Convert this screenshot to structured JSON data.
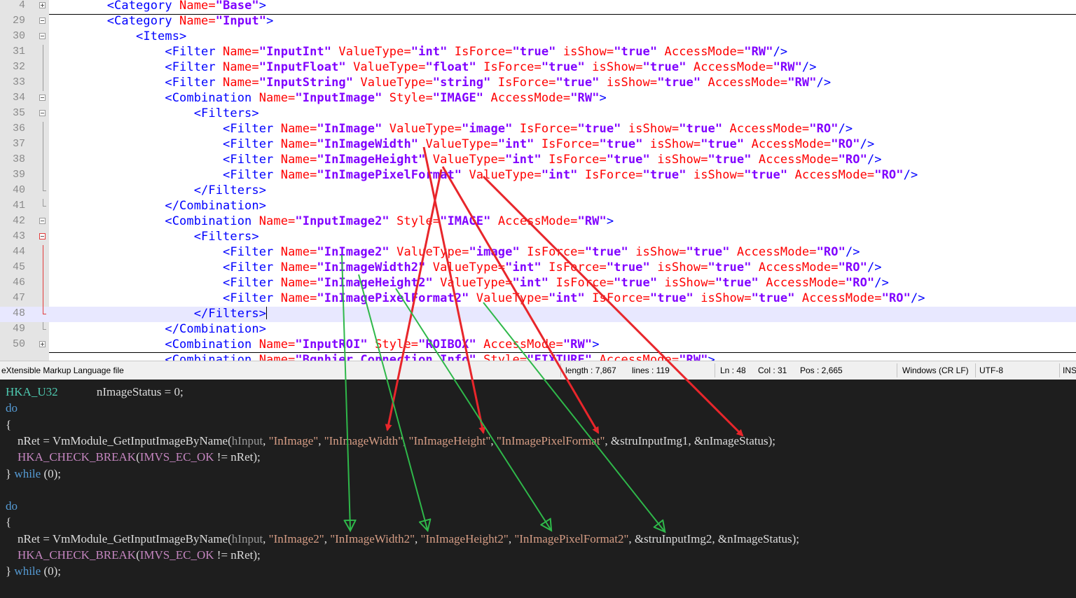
{
  "xml_lines": [
    {
      "num": "4",
      "fold": "plus",
      "segs": [
        [
          "p",
          "        "
        ],
        [
          "t",
          "<Category "
        ],
        [
          "a",
          "Name="
        ],
        [
          "v",
          "\"Base\""
        ],
        [
          "t",
          ">"
        ]
      ]
    },
    {
      "num": "29",
      "fold": "minus",
      "segs": [
        [
          "p",
          "        "
        ],
        [
          "t",
          "<Category "
        ],
        [
          "a",
          "Name="
        ],
        [
          "v",
          "\"Input\""
        ],
        [
          "t",
          ">"
        ]
      ]
    },
    {
      "num": "30",
      "fold": "minus",
      "segs": [
        [
          "p",
          "            "
        ],
        [
          "t",
          "<Items>"
        ]
      ]
    },
    {
      "num": "31",
      "fold": "line",
      "segs": [
        [
          "p",
          "                "
        ],
        [
          "t",
          "<Filter "
        ],
        [
          "a",
          "Name="
        ],
        [
          "v",
          "\"InputInt\""
        ],
        [
          "a",
          " ValueType="
        ],
        [
          "v",
          "\"int\""
        ],
        [
          "a",
          " IsForce="
        ],
        [
          "v",
          "\"true\""
        ],
        [
          "a",
          " isShow="
        ],
        [
          "v",
          "\"true\""
        ],
        [
          "a",
          " AccessMode="
        ],
        [
          "v",
          "\"RW\""
        ],
        [
          "t",
          "/>"
        ]
      ]
    },
    {
      "num": "32",
      "fold": "line",
      "segs": [
        [
          "p",
          "                "
        ],
        [
          "t",
          "<Filter "
        ],
        [
          "a",
          "Name="
        ],
        [
          "v",
          "\"InputFloat\""
        ],
        [
          "a",
          " ValueType="
        ],
        [
          "v",
          "\"float\""
        ],
        [
          "a",
          " IsForce="
        ],
        [
          "v",
          "\"true\""
        ],
        [
          "a",
          " isShow="
        ],
        [
          "v",
          "\"true\""
        ],
        [
          "a",
          " AccessMode="
        ],
        [
          "v",
          "\"RW\""
        ],
        [
          "t",
          "/>"
        ]
      ]
    },
    {
      "num": "33",
      "fold": "line",
      "segs": [
        [
          "p",
          "                "
        ],
        [
          "t",
          "<Filter "
        ],
        [
          "a",
          "Name="
        ],
        [
          "v",
          "\"InputString\""
        ],
        [
          "a",
          " ValueType="
        ],
        [
          "v",
          "\"string\""
        ],
        [
          "a",
          " IsForce="
        ],
        [
          "v",
          "\"true\""
        ],
        [
          "a",
          " isShow="
        ],
        [
          "v",
          "\"true\""
        ],
        [
          "a",
          " AccessMode="
        ],
        [
          "v",
          "\"RW\""
        ],
        [
          "t",
          "/>"
        ]
      ]
    },
    {
      "num": "34",
      "fold": "minus",
      "segs": [
        [
          "p",
          "                "
        ],
        [
          "t",
          "<Combination "
        ],
        [
          "a",
          "Name="
        ],
        [
          "v",
          "\"InputImage\""
        ],
        [
          "a",
          " Style="
        ],
        [
          "v",
          "\"IMAGE\""
        ],
        [
          "a",
          " AccessMode="
        ],
        [
          "v",
          "\"RW\""
        ],
        [
          "t",
          ">"
        ]
      ]
    },
    {
      "num": "35",
      "fold": "minus",
      "segs": [
        [
          "p",
          "                    "
        ],
        [
          "t",
          "<Filters>"
        ]
      ]
    },
    {
      "num": "36",
      "fold": "line",
      "segs": [
        [
          "p",
          "                        "
        ],
        [
          "t",
          "<Filter "
        ],
        [
          "a",
          "Name="
        ],
        [
          "v",
          "\"InImage\""
        ],
        [
          "a",
          " ValueType="
        ],
        [
          "v",
          "\"image\""
        ],
        [
          "a",
          " IsForce="
        ],
        [
          "v",
          "\"true\""
        ],
        [
          "a",
          " isShow="
        ],
        [
          "v",
          "\"true\""
        ],
        [
          "a",
          " AccessMode="
        ],
        [
          "v",
          "\"RO\""
        ],
        [
          "t",
          "/>"
        ]
      ]
    },
    {
      "num": "37",
      "fold": "line",
      "segs": [
        [
          "p",
          "                        "
        ],
        [
          "t",
          "<Filter "
        ],
        [
          "a",
          "Name="
        ],
        [
          "v",
          "\"InImageWidth\""
        ],
        [
          "a",
          " ValueType="
        ],
        [
          "v",
          "\"int\""
        ],
        [
          "a",
          " IsForce="
        ],
        [
          "v",
          "\"true\""
        ],
        [
          "a",
          " isShow="
        ],
        [
          "v",
          "\"true\""
        ],
        [
          "a",
          " AccessMode="
        ],
        [
          "v",
          "\"RO\""
        ],
        [
          "t",
          "/>"
        ]
      ]
    },
    {
      "num": "38",
      "fold": "line",
      "segs": [
        [
          "p",
          "                        "
        ],
        [
          "t",
          "<Filter "
        ],
        [
          "a",
          "Name="
        ],
        [
          "v",
          "\"InImageHeight\""
        ],
        [
          "a",
          " ValueType="
        ],
        [
          "v",
          "\"int\""
        ],
        [
          "a",
          " IsForce="
        ],
        [
          "v",
          "\"true\""
        ],
        [
          "a",
          " isShow="
        ],
        [
          "v",
          "\"true\""
        ],
        [
          "a",
          " AccessMode="
        ],
        [
          "v",
          "\"RO\""
        ],
        [
          "t",
          "/>"
        ]
      ]
    },
    {
      "num": "39",
      "fold": "line",
      "segs": [
        [
          "p",
          "                        "
        ],
        [
          "t",
          "<Filter "
        ],
        [
          "a",
          "Name="
        ],
        [
          "v",
          "\"InImagePixelFormat\""
        ],
        [
          "a",
          " ValueType="
        ],
        [
          "v",
          "\"int\""
        ],
        [
          "a",
          " IsForce="
        ],
        [
          "v",
          "\"true\""
        ],
        [
          "a",
          " isShow="
        ],
        [
          "v",
          "\"true\""
        ],
        [
          "a",
          " AccessMode="
        ],
        [
          "v",
          "\"RO\""
        ],
        [
          "t",
          "/>"
        ]
      ]
    },
    {
      "num": "40",
      "fold": "end",
      "segs": [
        [
          "p",
          "                    "
        ],
        [
          "t",
          "</Filters>"
        ]
      ]
    },
    {
      "num": "41",
      "fold": "end",
      "segs": [
        [
          "p",
          "                "
        ],
        [
          "t",
          "</Combination>"
        ]
      ]
    },
    {
      "num": "42",
      "fold": "minus",
      "segs": [
        [
          "p",
          "                "
        ],
        [
          "t",
          "<Combination "
        ],
        [
          "a",
          "Name="
        ],
        [
          "v",
          "\"InputImage2\""
        ],
        [
          "a",
          " Style="
        ],
        [
          "v",
          "\"IMAGE\""
        ],
        [
          "a",
          " AccessMode="
        ],
        [
          "v",
          "\"RW\""
        ],
        [
          "t",
          ">"
        ]
      ]
    },
    {
      "num": "43",
      "fold": "minus-red",
      "segs": [
        [
          "p",
          "                    "
        ],
        [
          "t",
          "<Filters>"
        ]
      ]
    },
    {
      "num": "44",
      "fold": "line-red",
      "segs": [
        [
          "p",
          "                        "
        ],
        [
          "t",
          "<Filter "
        ],
        [
          "a",
          "Name="
        ],
        [
          "v",
          "\"InImage2\""
        ],
        [
          "a",
          " ValueType="
        ],
        [
          "v",
          "\"image\""
        ],
        [
          "a",
          " IsForce="
        ],
        [
          "v",
          "\"true\""
        ],
        [
          "a",
          " isShow="
        ],
        [
          "v",
          "\"true\""
        ],
        [
          "a",
          " AccessMode="
        ],
        [
          "v",
          "\"RO\""
        ],
        [
          "t",
          "/>"
        ]
      ]
    },
    {
      "num": "45",
      "fold": "line-red",
      "segs": [
        [
          "p",
          "                        "
        ],
        [
          "t",
          "<Filter "
        ],
        [
          "a",
          "Name="
        ],
        [
          "v",
          "\"InImageWidth2\""
        ],
        [
          "a",
          " ValueType="
        ],
        [
          "v",
          "\"int\""
        ],
        [
          "a",
          " IsForce="
        ],
        [
          "v",
          "\"true\""
        ],
        [
          "a",
          " isShow="
        ],
        [
          "v",
          "\"true\""
        ],
        [
          "a",
          " AccessMode="
        ],
        [
          "v",
          "\"RO\""
        ],
        [
          "t",
          "/>"
        ]
      ]
    },
    {
      "num": "46",
      "fold": "line-red",
      "segs": [
        [
          "p",
          "                        "
        ],
        [
          "t",
          "<Filter "
        ],
        [
          "a",
          "Name="
        ],
        [
          "v",
          "\"InImageHeight2\""
        ],
        [
          "a",
          " ValueType="
        ],
        [
          "v",
          "\"int\""
        ],
        [
          "a",
          " IsForce="
        ],
        [
          "v",
          "\"true\""
        ],
        [
          "a",
          " isShow="
        ],
        [
          "v",
          "\"true\""
        ],
        [
          "a",
          " AccessMode="
        ],
        [
          "v",
          "\"RO\""
        ],
        [
          "t",
          "/>"
        ]
      ]
    },
    {
      "num": "47",
      "fold": "line-red",
      "segs": [
        [
          "p",
          "                        "
        ],
        [
          "t",
          "<Filter "
        ],
        [
          "a",
          "Name="
        ],
        [
          "v",
          "\"InImagePixelFormat2\""
        ],
        [
          "a",
          " ValueType="
        ],
        [
          "v",
          "\"int\""
        ],
        [
          "a",
          " IsForce="
        ],
        [
          "v",
          "\"true\""
        ],
        [
          "a",
          " isShow="
        ],
        [
          "v",
          "\"true\""
        ],
        [
          "a",
          " AccessMode="
        ],
        [
          "v",
          "\"RO\""
        ],
        [
          "t",
          "/>"
        ]
      ]
    },
    {
      "num": "48",
      "fold": "end-red",
      "current": true,
      "segs": [
        [
          "p",
          "                    "
        ],
        [
          "t",
          "</Filters>"
        ]
      ]
    },
    {
      "num": "49",
      "fold": "end",
      "segs": [
        [
          "p",
          "                "
        ],
        [
          "t",
          "</Combination>"
        ]
      ]
    },
    {
      "num": "50",
      "fold": "plus",
      "segs": [
        [
          "p",
          "                "
        ],
        [
          "t",
          "<Combination "
        ],
        [
          "a",
          "Name="
        ],
        [
          "v",
          "\"InputROI\""
        ],
        [
          "a",
          " Style="
        ],
        [
          "v",
          "\"ROIBOX\""
        ],
        [
          "a",
          " AccessMode="
        ],
        [
          "v",
          "\"RW\""
        ],
        [
          "t",
          ">"
        ]
      ]
    },
    {
      "num": "",
      "fold": "none",
      "segs": [
        [
          "p",
          "                "
        ],
        [
          "t",
          "<Combination "
        ],
        [
          "a",
          "Name="
        ],
        [
          "v",
          "\"Bgnhier Connection Info\""
        ],
        [
          "a",
          " Style="
        ],
        [
          "v",
          "\"FIXTURE\""
        ],
        [
          "a",
          " AccessMode="
        ],
        [
          "v",
          "\"RW\""
        ],
        [
          "t",
          ">"
        ]
      ]
    }
  ],
  "status": {
    "file_type": "eXtensible Markup Language file",
    "length": "length : 7,867",
    "lines": "lines : 119",
    "ln": "Ln : 48",
    "col": "Col : 31",
    "pos": "Pos : 2,665",
    "eol": "Windows (CR LF)",
    "encoding": "UTF-8",
    "mode": "INS"
  },
  "code_lines": [
    {
      "segs": [
        [
          "cty",
          "HKA_U32"
        ],
        [
          "cpl",
          "             nImageStatus = 0;"
        ]
      ]
    },
    {
      "segs": [
        [
          "ckw",
          "do"
        ]
      ]
    },
    {
      "segs": [
        [
          "cpl",
          "{"
        ]
      ]
    },
    {
      "segs": [
        [
          "cpl",
          "    nRet = VmModule_GetInputImageByName("
        ],
        [
          "cparam",
          "hInput"
        ],
        [
          "cpl",
          ", "
        ],
        [
          "cstr",
          "\"InImage\""
        ],
        [
          "cpl",
          ", "
        ],
        [
          "cstr",
          "\"InImageWidth\""
        ],
        [
          "cpl",
          ", "
        ],
        [
          "cstr",
          "\"InImageHeight\""
        ],
        [
          "cpl",
          ", "
        ],
        [
          "cstr",
          "\"InImagePixelFormat\""
        ],
        [
          "cpl",
          ", &struInputImg1, &nImageStatus);"
        ]
      ]
    },
    {
      "segs": [
        [
          "cpl",
          "    "
        ],
        [
          "cmac",
          "HKA_CHECK_BREAK"
        ],
        [
          "cpl",
          "("
        ],
        [
          "cmac",
          "IMVS_EC_OK"
        ],
        [
          "cpl",
          " != nRet);"
        ]
      ]
    },
    {
      "segs": [
        [
          "cpl",
          "} "
        ],
        [
          "ckw",
          "while"
        ],
        [
          "cpl",
          " (0);"
        ]
      ]
    },
    {
      "segs": [
        [
          "cpl",
          " "
        ]
      ]
    },
    {
      "segs": [
        [
          "ckw",
          "do"
        ]
      ]
    },
    {
      "segs": [
        [
          "cpl",
          "{"
        ]
      ]
    },
    {
      "segs": [
        [
          "cpl",
          "    nRet = VmModule_GetInputImageByName("
        ],
        [
          "cparam",
          "hInput"
        ],
        [
          "cpl",
          ", "
        ],
        [
          "cstr",
          "\"InImage2\""
        ],
        [
          "cpl",
          ", "
        ],
        [
          "cstr",
          "\"InImageWidth2\""
        ],
        [
          "cpl",
          ", "
        ],
        [
          "cstr",
          "\"InImageHeight2\""
        ],
        [
          "cpl",
          ", "
        ],
        [
          "cstr",
          "\"InImagePixelFormat2\""
        ],
        [
          "cpl",
          ", &struInputImg2, &nImageStatus);"
        ]
      ]
    },
    {
      "segs": [
        [
          "cpl",
          "    "
        ],
        [
          "cmac",
          "HKA_CHECK_BREAK"
        ],
        [
          "cpl",
          "("
        ],
        [
          "cmac",
          "IMVS_EC_OK"
        ],
        [
          "cpl",
          " != nRet);"
        ]
      ]
    },
    {
      "segs": [
        [
          "cpl",
          "} "
        ],
        [
          "ckw",
          "while"
        ],
        [
          "cpl",
          " (0);"
        ]
      ]
    }
  ],
  "annotation_colors": {
    "red_arrow": "#e8262b",
    "green_arrow": "#2fb84a"
  }
}
